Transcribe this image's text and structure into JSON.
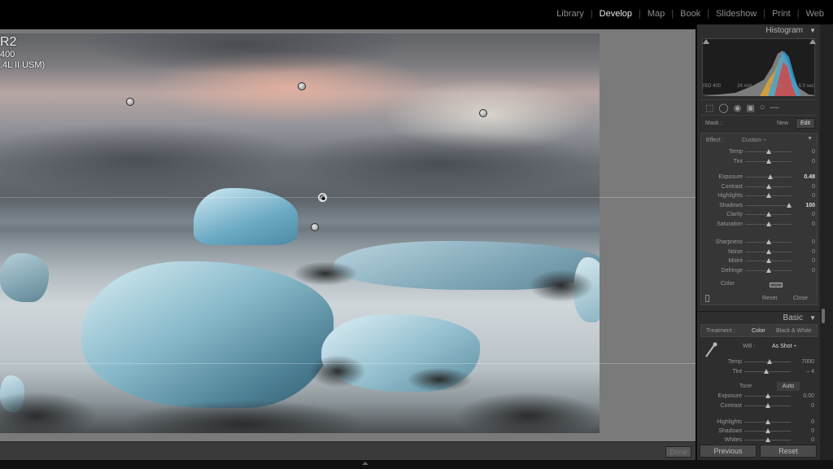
{
  "modules": [
    "Library",
    "Develop",
    "Map",
    "Book",
    "Slideshow",
    "Print",
    "Web"
  ],
  "active_module": "Develop",
  "photo_info": {
    "line1": "R2",
    "line2": "400",
    "line3": ".4L II USM)"
  },
  "histogram": {
    "title": "Histogram",
    "iso": "ISO 400",
    "focal": "24 mm",
    "aperture": "ƒ / 8.0",
    "shutter": "5.0 sec"
  },
  "mask": {
    "label": "Mask :",
    "new": "New",
    "edit": "Edit"
  },
  "effect": {
    "label": "Effect :",
    "preset": "Custom ÷",
    "group1": [
      {
        "label": "Temp",
        "value": "0",
        "pos": 0.5
      },
      {
        "label": "Tint",
        "value": "0",
        "pos": 0.5
      }
    ],
    "group2": [
      {
        "label": "Exposure",
        "value": "0.48",
        "pos": 0.55,
        "bold": true
      },
      {
        "label": "Contrast",
        "value": "0",
        "pos": 0.5
      },
      {
        "label": "Highlights",
        "value": "0",
        "pos": 0.5
      },
      {
        "label": "Shadows",
        "value": "100",
        "pos": 0.95,
        "bold": true
      },
      {
        "label": "Clarity",
        "value": "0",
        "pos": 0.5
      },
      {
        "label": "Saturation",
        "value": "0",
        "pos": 0.5
      }
    ],
    "group3": [
      {
        "label": "Sharpness",
        "value": "0",
        "pos": 0.5
      },
      {
        "label": "Noise",
        "value": "0",
        "pos": 0.5
      },
      {
        "label": "Moiré",
        "value": "0",
        "pos": 0.5
      },
      {
        "label": "Defringe",
        "value": "0",
        "pos": 0.5
      }
    ],
    "color_label": "Color",
    "reset": "Reset",
    "close": "Close"
  },
  "basic": {
    "title": "Basic",
    "treatment_label": "Treatment :",
    "color": "Color",
    "bw": "Black & White",
    "wb_label": "WB :",
    "wb_value": "As Shot ÷",
    "wb_rows": [
      {
        "label": "Temp",
        "value": "7000",
        "pos": 0.55
      },
      {
        "label": "Tint",
        "value": "– 4",
        "pos": 0.48
      }
    ],
    "tone_label": "Tone",
    "auto": "Auto",
    "tone_rows": [
      {
        "label": "Exposure",
        "value": "0.00",
        "pos": 0.5
      },
      {
        "label": "Contrast",
        "value": "0",
        "pos": 0.5
      }
    ],
    "tone_rows2": [
      {
        "label": "Highlights",
        "value": "0",
        "pos": 0.5
      },
      {
        "label": "Shadows",
        "value": "0",
        "pos": 0.5
      },
      {
        "label": "Whites",
        "value": "0",
        "pos": 0.5
      }
    ]
  },
  "buttons": {
    "done": "Done",
    "previous": "Previous",
    "reset": "Reset"
  }
}
